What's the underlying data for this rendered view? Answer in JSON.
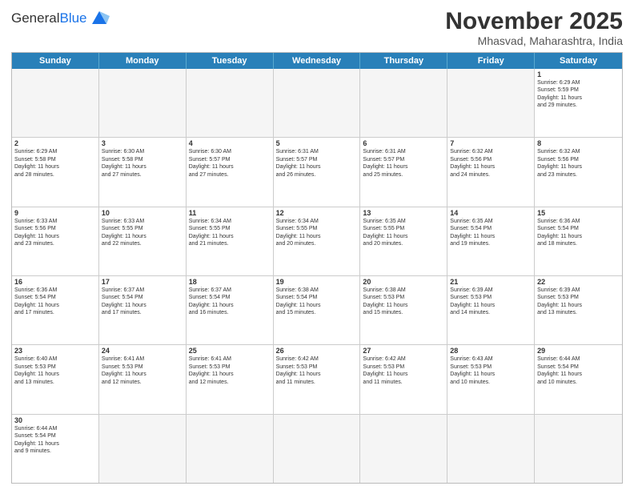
{
  "logo": {
    "text_general": "General",
    "text_blue": "Blue"
  },
  "title": "November 2025",
  "subtitle": "Mhasvad, Maharashtra, India",
  "days": [
    "Sunday",
    "Monday",
    "Tuesday",
    "Wednesday",
    "Thursday",
    "Friday",
    "Saturday"
  ],
  "rows": [
    [
      {
        "day": "",
        "text": ""
      },
      {
        "day": "",
        "text": ""
      },
      {
        "day": "",
        "text": ""
      },
      {
        "day": "",
        "text": ""
      },
      {
        "day": "",
        "text": ""
      },
      {
        "day": "",
        "text": ""
      },
      {
        "day": "1",
        "text": "Sunrise: 6:29 AM\nSunset: 5:59 PM\nDaylight: 11 hours\nand 29 minutes."
      }
    ],
    [
      {
        "day": "2",
        "text": "Sunrise: 6:29 AM\nSunset: 5:58 PM\nDaylight: 11 hours\nand 28 minutes."
      },
      {
        "day": "3",
        "text": "Sunrise: 6:30 AM\nSunset: 5:58 PM\nDaylight: 11 hours\nand 27 minutes."
      },
      {
        "day": "4",
        "text": "Sunrise: 6:30 AM\nSunset: 5:57 PM\nDaylight: 11 hours\nand 27 minutes."
      },
      {
        "day": "5",
        "text": "Sunrise: 6:31 AM\nSunset: 5:57 PM\nDaylight: 11 hours\nand 26 minutes."
      },
      {
        "day": "6",
        "text": "Sunrise: 6:31 AM\nSunset: 5:57 PM\nDaylight: 11 hours\nand 25 minutes."
      },
      {
        "day": "7",
        "text": "Sunrise: 6:32 AM\nSunset: 5:56 PM\nDaylight: 11 hours\nand 24 minutes."
      },
      {
        "day": "8",
        "text": "Sunrise: 6:32 AM\nSunset: 5:56 PM\nDaylight: 11 hours\nand 23 minutes."
      }
    ],
    [
      {
        "day": "9",
        "text": "Sunrise: 6:33 AM\nSunset: 5:56 PM\nDaylight: 11 hours\nand 23 minutes."
      },
      {
        "day": "10",
        "text": "Sunrise: 6:33 AM\nSunset: 5:55 PM\nDaylight: 11 hours\nand 22 minutes."
      },
      {
        "day": "11",
        "text": "Sunrise: 6:34 AM\nSunset: 5:55 PM\nDaylight: 11 hours\nand 21 minutes."
      },
      {
        "day": "12",
        "text": "Sunrise: 6:34 AM\nSunset: 5:55 PM\nDaylight: 11 hours\nand 20 minutes."
      },
      {
        "day": "13",
        "text": "Sunrise: 6:35 AM\nSunset: 5:55 PM\nDaylight: 11 hours\nand 20 minutes."
      },
      {
        "day": "14",
        "text": "Sunrise: 6:35 AM\nSunset: 5:54 PM\nDaylight: 11 hours\nand 19 minutes."
      },
      {
        "day": "15",
        "text": "Sunrise: 6:36 AM\nSunset: 5:54 PM\nDaylight: 11 hours\nand 18 minutes."
      }
    ],
    [
      {
        "day": "16",
        "text": "Sunrise: 6:36 AM\nSunset: 5:54 PM\nDaylight: 11 hours\nand 17 minutes."
      },
      {
        "day": "17",
        "text": "Sunrise: 6:37 AM\nSunset: 5:54 PM\nDaylight: 11 hours\nand 17 minutes."
      },
      {
        "day": "18",
        "text": "Sunrise: 6:37 AM\nSunset: 5:54 PM\nDaylight: 11 hours\nand 16 minutes."
      },
      {
        "day": "19",
        "text": "Sunrise: 6:38 AM\nSunset: 5:54 PM\nDaylight: 11 hours\nand 15 minutes."
      },
      {
        "day": "20",
        "text": "Sunrise: 6:38 AM\nSunset: 5:53 PM\nDaylight: 11 hours\nand 15 minutes."
      },
      {
        "day": "21",
        "text": "Sunrise: 6:39 AM\nSunset: 5:53 PM\nDaylight: 11 hours\nand 14 minutes."
      },
      {
        "day": "22",
        "text": "Sunrise: 6:39 AM\nSunset: 5:53 PM\nDaylight: 11 hours\nand 13 minutes."
      }
    ],
    [
      {
        "day": "23",
        "text": "Sunrise: 6:40 AM\nSunset: 5:53 PM\nDaylight: 11 hours\nand 13 minutes."
      },
      {
        "day": "24",
        "text": "Sunrise: 6:41 AM\nSunset: 5:53 PM\nDaylight: 11 hours\nand 12 minutes."
      },
      {
        "day": "25",
        "text": "Sunrise: 6:41 AM\nSunset: 5:53 PM\nDaylight: 11 hours\nand 12 minutes."
      },
      {
        "day": "26",
        "text": "Sunrise: 6:42 AM\nSunset: 5:53 PM\nDaylight: 11 hours\nand 11 minutes."
      },
      {
        "day": "27",
        "text": "Sunrise: 6:42 AM\nSunset: 5:53 PM\nDaylight: 11 hours\nand 11 minutes."
      },
      {
        "day": "28",
        "text": "Sunrise: 6:43 AM\nSunset: 5:53 PM\nDaylight: 11 hours\nand 10 minutes."
      },
      {
        "day": "29",
        "text": "Sunrise: 6:44 AM\nSunset: 5:54 PM\nDaylight: 11 hours\nand 10 minutes."
      }
    ],
    [
      {
        "day": "30",
        "text": "Sunrise: 6:44 AM\nSunset: 5:54 PM\nDaylight: 11 hours\nand 9 minutes."
      },
      {
        "day": "",
        "text": ""
      },
      {
        "day": "",
        "text": ""
      },
      {
        "day": "",
        "text": ""
      },
      {
        "day": "",
        "text": ""
      },
      {
        "day": "",
        "text": ""
      },
      {
        "day": "",
        "text": ""
      }
    ]
  ]
}
